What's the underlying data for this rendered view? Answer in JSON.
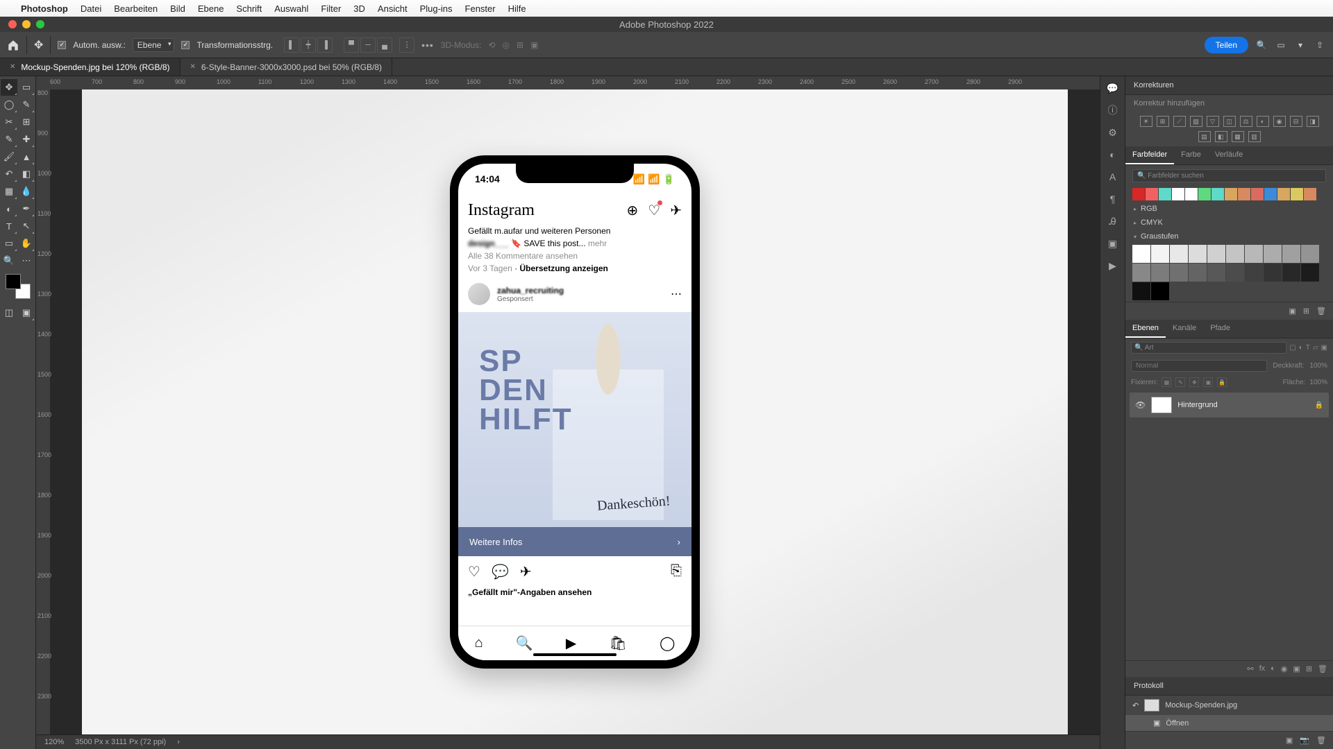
{
  "menubar": {
    "app": "Photoshop",
    "items": [
      "Datei",
      "Bearbeiten",
      "Bild",
      "Ebene",
      "Schrift",
      "Auswahl",
      "Filter",
      "3D",
      "Ansicht",
      "Plug-ins",
      "Fenster",
      "Hilfe"
    ]
  },
  "window_title": "Adobe Photoshop 2022",
  "optbar": {
    "auto": "Autom. ausw.:",
    "layer": "Ebene",
    "transform": "Transformationsstrg.",
    "mode3d": "3D-Modus:",
    "share": "Teilen"
  },
  "tabs": [
    {
      "label": "Mockup-Spenden.jpg bei 120% (RGB/8)",
      "active": true
    },
    {
      "label": "6-Style-Banner-3000x3000.psd bei 50% (RGB/8)",
      "active": false
    }
  ],
  "ruler_h": [
    "600",
    "700",
    "800",
    "900",
    "1000",
    "1100",
    "1200",
    "1300",
    "1400",
    "1500",
    "1600",
    "1700",
    "1800",
    "1900",
    "2000",
    "2100",
    "2200",
    "2300",
    "2400",
    "2500",
    "2600",
    "2700",
    "2800",
    "2900"
  ],
  "ruler_v": [
    "800",
    "900",
    "1000",
    "1100",
    "1200",
    "1300",
    "1400",
    "1500",
    "1600",
    "1700",
    "1800",
    "1900",
    "2000",
    "2100",
    "2200",
    "2300"
  ],
  "status": {
    "zoom": "120%",
    "dims": "3500 Px x 3111 Px (72 ppi)"
  },
  "phone": {
    "time": "14:04",
    "logo": "Instagram",
    "caption_line1": "Gefällt m.aufar und weiteren Personen",
    "caption_line2": "🔖 SAVE this post...",
    "more": "mehr",
    "comments": "Alle 38 Kommentare ansehen",
    "ago": "Vor 3 Tagen",
    "translate": "Übersetzung anzeigen",
    "username": "zahua_recruiting",
    "sponsored": "Gesponsert",
    "big1": "SP",
    "big2": "DEN",
    "big3": "HILFT",
    "script": "Dankeschön!",
    "cta": "Weitere Infos",
    "likes": "„Gefällt mir\"-Angaben ansehen"
  },
  "panels": {
    "adjustments": {
      "title": "Korrekturen",
      "add": "Korrektur hinzufügen"
    },
    "swatches": {
      "tabs": [
        "Farbfelder",
        "Farbe",
        "Verläufe"
      ],
      "search": "Farbfelder suchen",
      "f_rgb": "RGB",
      "f_cmyk": "CMYK",
      "f_gray": "Graustufen"
    },
    "layers": {
      "tabs": [
        "Ebenen",
        "Kanäle",
        "Pfade"
      ],
      "kind": "Art",
      "blend": "Normal",
      "opacity_l": "Deckkraft:",
      "opacity_v": "100%",
      "lock_l": "Fixieren:",
      "fill_l": "Fläche:",
      "fill_v": "100%",
      "layer1": "Hintergrund"
    },
    "history": {
      "title": "Protokoll",
      "doc": "Mockup-Spenden.jpg",
      "step": "Öffnen"
    }
  },
  "colors": {
    "row1": [
      "#d92626",
      "#f06262",
      "#5fd9c8",
      "#ffffff",
      "#ffffff",
      "#5fd980",
      "#5fd9c8",
      "#d9a65f",
      "#d9895f",
      "#d96c5f",
      "#3b8bd9",
      "#d9a65f",
      "#d9c95f",
      "#d9895f"
    ],
    "grays": [
      "#ffffff",
      "#f4f4f4",
      "#e8e8e8",
      "#dcdcdc",
      "#d0d0d0",
      "#c4c4c4",
      "#b8b8b8",
      "#acacac",
      "#a0a0a0",
      "#949494",
      "#888888",
      "#7c7c7c",
      "#707070",
      "#646464",
      "#585858",
      "#4c4c4c",
      "#404040",
      "#343434",
      "#282828",
      "#1c1c1c",
      "#101010",
      "#000000"
    ]
  }
}
